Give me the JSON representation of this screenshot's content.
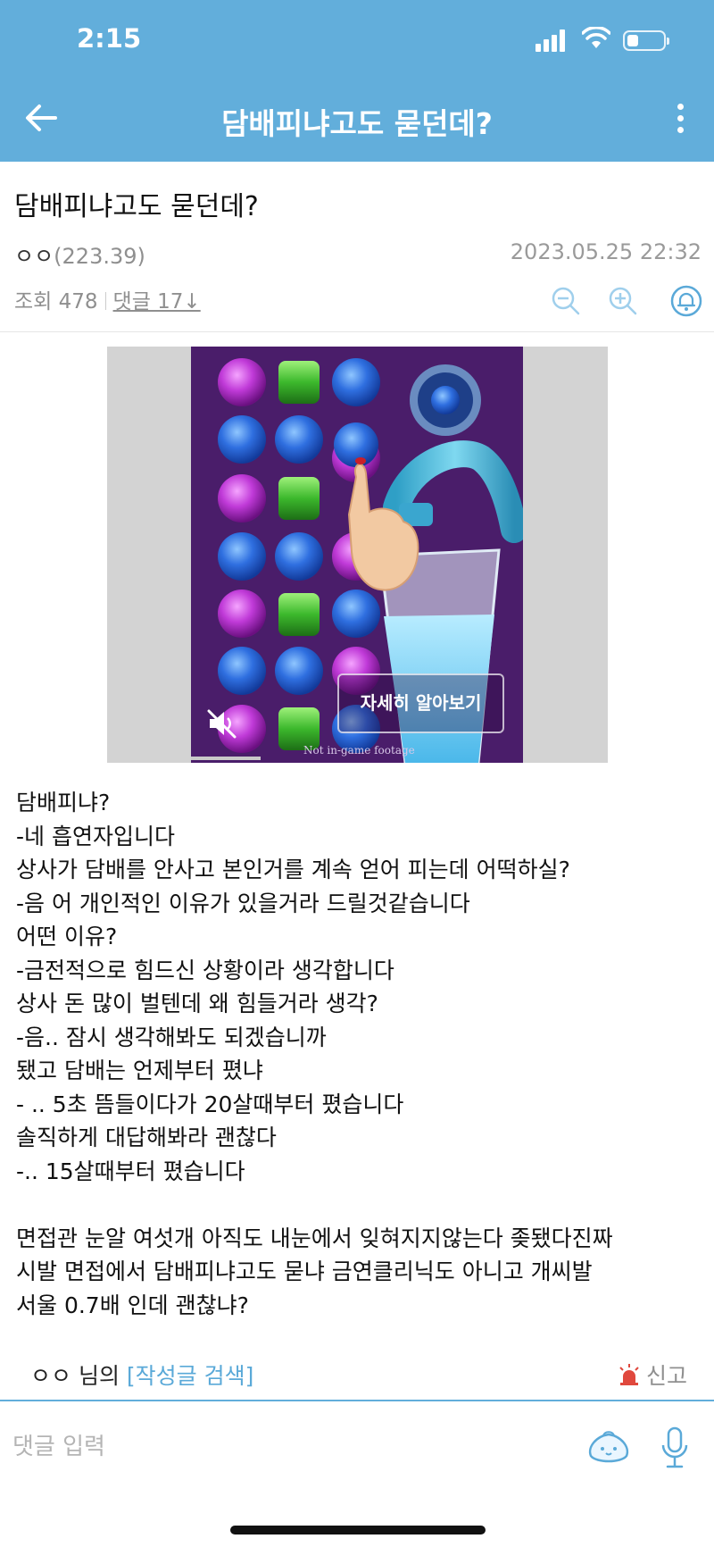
{
  "status_bar": {
    "time": "2:15"
  },
  "header": {
    "title": "담배피냐고도 묻던데?"
  },
  "post": {
    "title": "담배피냐고도 묻던데?",
    "author": "ㅇㅇ",
    "ip": "(223.39)",
    "date": "2023.05.25 22:32",
    "views_label": "조회 478",
    "comments_label": "댓글 17↓"
  },
  "ad": {
    "cta_label": "자세히 알아보기",
    "footnote": "Not in-game footage"
  },
  "body_lines": [
    "담배피냐?",
    "-네 흡연자입니다",
    "상사가 담배를 안사고 본인거를 계속 얻어 피는데 어떡하실?",
    "-음 어 개인적인 이유가 있을거라 드릴것같습니다",
    "어떤 이유?",
    "-금전적으로 힘드신 상황이라 생각합니다",
    "상사 돈 많이 벌텐데 왜 힘들거라 생각?",
    "-음.. 잠시 생각해봐도 되겠습니까",
    "됐고 담배는 언제부터 폈냐",
    "- .. 5초 뜸들이다가 20살때부터 폈습니다",
    "솔직하게 대답해봐라 괜찮다",
    "-.. 15살때부터 폈습니다",
    "",
    "면접관 눈알 여섯개 아직도 내눈에서 잊혀지지않는다 좆됐다진짜",
    "시발 면접에서 담배피냐고도 묻냐 금연클리닉도 아니고 개씨발",
    "서울 0.7배 인데 괜찮냐?"
  ],
  "footer": {
    "author_prefix": "ㅇㅇ 님의 ",
    "search_link": "[작성글 검색]",
    "report_label": "신고"
  },
  "comment_box": {
    "placeholder": "댓글 입력"
  },
  "colors": {
    "header_bg": "#62aedb",
    "link": "#5aa9d8",
    "ad_bg": "#4a1d6a"
  }
}
